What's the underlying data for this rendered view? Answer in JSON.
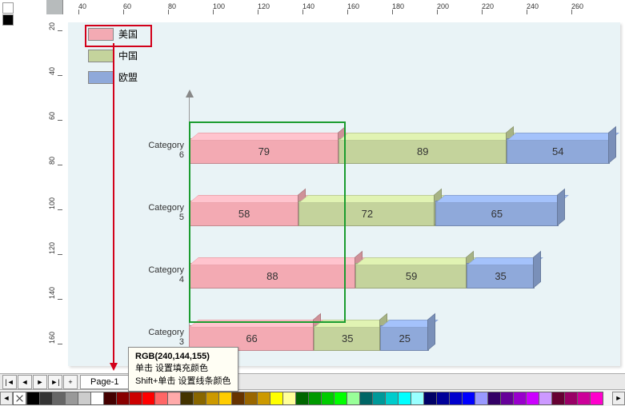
{
  "ruler": {
    "h_marks": [
      "40",
      "60",
      "80",
      "100",
      "120",
      "140",
      "160",
      "180",
      "200",
      "220",
      "240",
      "260"
    ],
    "v_marks": [
      "20",
      "40",
      "60",
      "80",
      "100",
      "120",
      "140",
      "160"
    ]
  },
  "legend": {
    "items": [
      {
        "label": "美国",
        "color": "#f3aab3"
      },
      {
        "label": "中国",
        "color": "#c4d39c"
      },
      {
        "label": "欧盟",
        "color": "#8fa9da"
      }
    ]
  },
  "chart_data": {
    "type": "bar",
    "orientation": "horizontal-stacked",
    "categories": [
      "Category 6",
      "Category 5",
      "Category 4",
      "Category 3"
    ],
    "series": [
      {
        "name": "美国",
        "values": [
          79,
          58,
          88,
          66
        ]
      },
      {
        "name": "中国",
        "values": [
          89,
          72,
          59,
          35
        ]
      },
      {
        "name": "欧盟",
        "values": [
          54,
          65,
          35,
          25
        ]
      }
    ],
    "xlabel": "",
    "ylabel": "",
    "title": ""
  },
  "tooltip": {
    "title": "RGB(240,144,155)",
    "line1": "单击 设置填充颜色",
    "line2": "Shift+单击 设置线条颜色"
  },
  "page_nav": {
    "first": "|◄",
    "prev": "◄",
    "next": "►",
    "last": "►|",
    "add": "+",
    "tab": "Page-1"
  },
  "palette": {
    "left_arrow": "◄",
    "right_arrow": "►",
    "colors": [
      "#000",
      "#333",
      "#666",
      "#999",
      "#ccc",
      "#fff",
      "#400",
      "#800",
      "#c00",
      "#f00",
      "#f66",
      "#faa",
      "#430",
      "#860",
      "#c90",
      "#fc0",
      "#630",
      "#960",
      "#c90",
      "#ff0",
      "#ff9",
      "#060",
      "#090",
      "#0c0",
      "#0f0",
      "#9f9",
      "#066",
      "#099",
      "#0cc",
      "#0ff",
      "#9ff",
      "#006",
      "#009",
      "#00c",
      "#00f",
      "#99f",
      "#306",
      "#609",
      "#90c",
      "#c0f",
      "#c9f",
      "#603",
      "#906",
      "#c09",
      "#f0c"
    ]
  }
}
